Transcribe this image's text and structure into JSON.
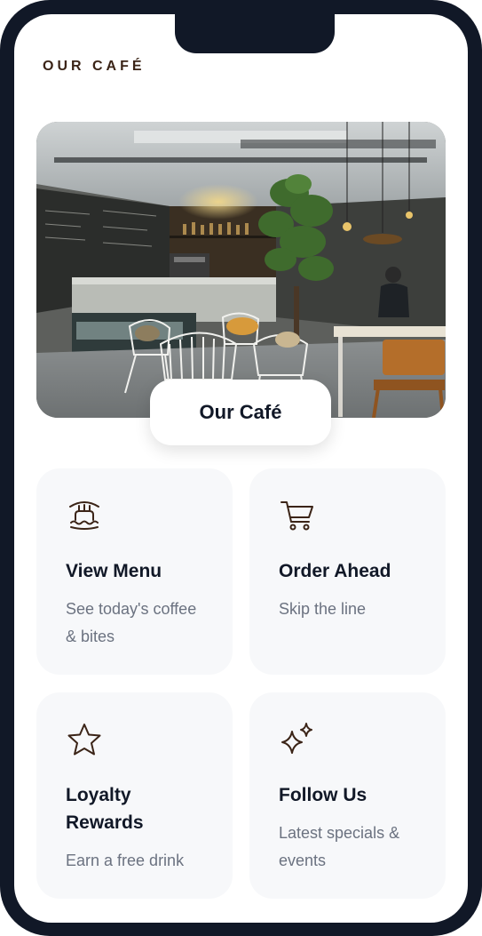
{
  "header": {
    "brand": "OUR CAFÉ"
  },
  "hero": {
    "label": "Our Café"
  },
  "cards": [
    {
      "icon": "cake-icon",
      "title": "View Menu",
      "description": "See today's coffee & bites"
    },
    {
      "icon": "cart-icon",
      "title": "Order Ahead",
      "description": "Skip the line"
    },
    {
      "icon": "star-icon",
      "title": "Loyalty Rewards",
      "description": "Earn a free drink"
    },
    {
      "icon": "sparkles-icon",
      "title": "Follow Us",
      "description": "Latest specials & events"
    }
  ],
  "colors": {
    "frame": "#111827",
    "accent": "#3b2417",
    "card_bg": "#f7f8fa",
    "text_primary": "#111827",
    "text_secondary": "#6b7280"
  }
}
